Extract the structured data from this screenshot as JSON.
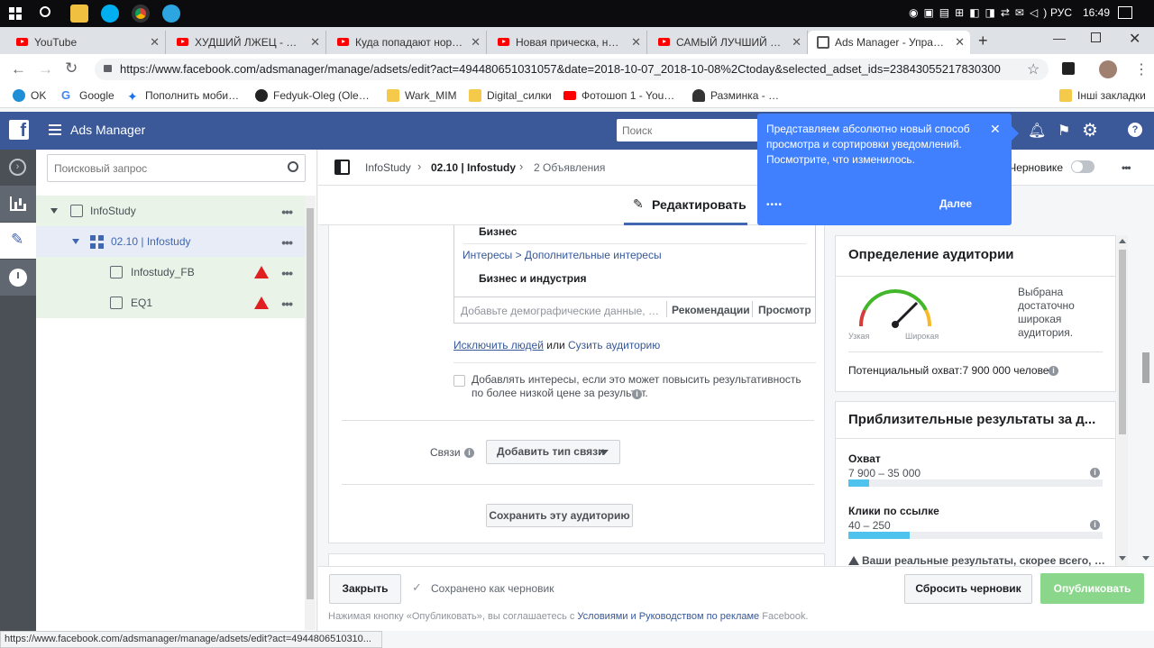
{
  "taskbar": {
    "lang": "РУС",
    "time": "16:49"
  },
  "tabs": [
    {
      "title": "YouTube"
    },
    {
      "title": "ХУДШИЙ ЛЖЕЦ - YouT"
    },
    {
      "title": "Куда попадают норм л"
    },
    {
      "title": "Новая прическа, новы"
    },
    {
      "title": "САМЫЙ ЛУЧШИЙ ЛЖЕ"
    },
    {
      "title": "Ads Manager - Управле"
    }
  ],
  "address": {
    "url": "https://www.facebook.com/adsmanager/manage/adsets/edit?act=494480651031057&date=2018-10-07_2018-10-08%2Ctoday&selected_adset_ids=23843055217830300"
  },
  "bookmarks": [
    "OK",
    "Google",
    "Пополнить мобильн",
    "Fedyuk-Oleg (Oleg F",
    "Wark_MIM",
    "Digital_силки",
    "Фотошоп 1 - YouTub",
    "Разминка - переводч",
    "Інші закладки"
  ],
  "header": {
    "title": "Ads Manager",
    "search_placeholder": "Поиск"
  },
  "sidebar": {
    "search_placeholder": "Поисковый запрос"
  },
  "tree": [
    {
      "label": "InfoStudy"
    },
    {
      "label": "02.10 | Infostudy"
    },
    {
      "label": "Infostudy_FB"
    },
    {
      "label": "EQ1"
    }
  ],
  "breadcrumb": {
    "account": "InfoStudy",
    "adset": "02.10 | Infostudy",
    "ads": "2 Объявления",
    "draft_label": "Черновике"
  },
  "edit_tab": "Редактировать",
  "targeting": {
    "business": "Бизнес",
    "interests_path": "Интересы > Дополнительные интересы",
    "industry": "Бизнес и индустрия",
    "add_placeholder": "Добавьте демографические данные, и...",
    "recommendations": "Рекомендации",
    "view": "Просмотр",
    "exclude": "Исключить людей",
    "or": "или",
    "narrow": "Сузить аудиторию",
    "expand_checkbox": "Добавлять интересы, если это может повысить результативность по более низкой цене за результат.",
    "connections_label": "Связи",
    "add_connection": "Добавить тип связи",
    "save_audience": "Сохранить эту аудиторию"
  },
  "audience": {
    "title": "Определение аудитории",
    "narrow": "Узкая",
    "broad": "Широкая",
    "status": "Выбрана достаточно широкая аудитория.",
    "reach": "Потенциальный охват:7 900 000 человек"
  },
  "estimates": {
    "title": "Приблизительные результаты за д...",
    "reach_label": "Охват",
    "reach_value": "7 900 – 35 000",
    "reach_fill": 0.08,
    "clicks_label": "Клики по ссылке",
    "clicks_value": "40 – 250",
    "clicks_fill": 0.24,
    "note": "Ваши реальные результаты, скорее всего, будут"
  },
  "popup": {
    "text": "Представляем абсолютно новый способ просмотра и сортировки уведомлений. Посмотрите, что изменилось.",
    "next": "Далее"
  },
  "footer": {
    "close": "Закрыть",
    "saved": "Сохранено как черновик",
    "discard": "Сбросить черновик",
    "publish": "Опубликовать",
    "terms_prefix": "Нажимая кнопку «Опубликовать», вы соглашаетесь с",
    "terms_link": "Условиями и Руководством по рекламе",
    "terms_suffix": "Facebook."
  },
  "status_url": "https://www.facebook.com/adsmanager/manage/adsets/edit?act=4944806510310...",
  "colors": {
    "fb_blue": "#3b5998",
    "popup_blue": "#4080ff",
    "publish_green": "#8ad68a",
    "warning_red": "#e02020",
    "bar_fill": "#4dc3ee"
  }
}
